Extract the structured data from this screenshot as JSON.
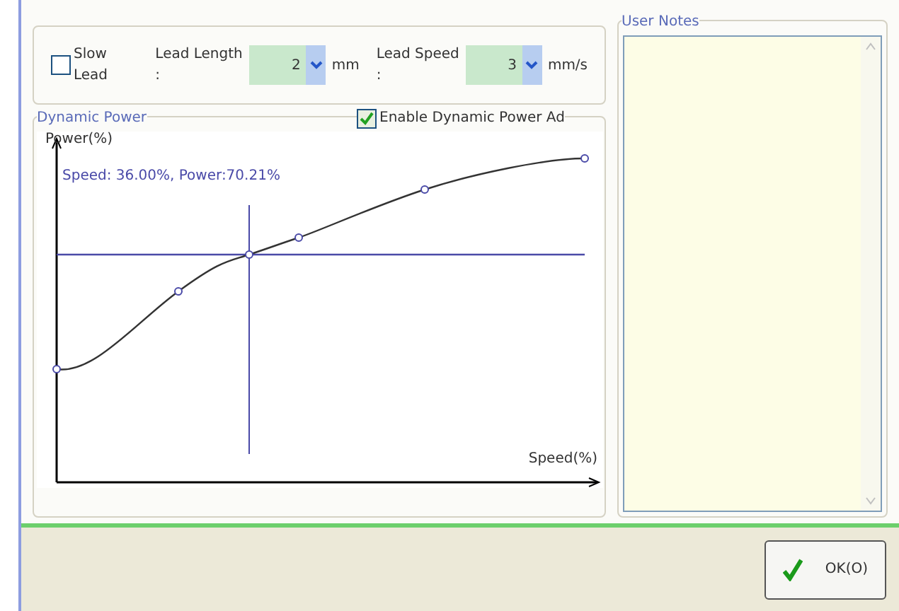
{
  "lead": {
    "slow_lead": {
      "label": "Slow Lead",
      "checked": false
    },
    "length": {
      "label": "Lead Length :",
      "value": "2",
      "unit": "mm"
    },
    "speed": {
      "label": "Lead Speed :",
      "value": "3",
      "unit": "mm/s"
    }
  },
  "dynamic_power": {
    "title": "Dynamic Power",
    "enable": {
      "label": "Enable Dynamic Power Ad",
      "checked": true
    },
    "y_label": "Power(%)",
    "x_label": "Speed(%)",
    "readout": "Speed: 36.00%, Power:70.21%"
  },
  "user_notes": {
    "title": "User Notes"
  },
  "ok_button": {
    "label": "OK(O)"
  }
}
